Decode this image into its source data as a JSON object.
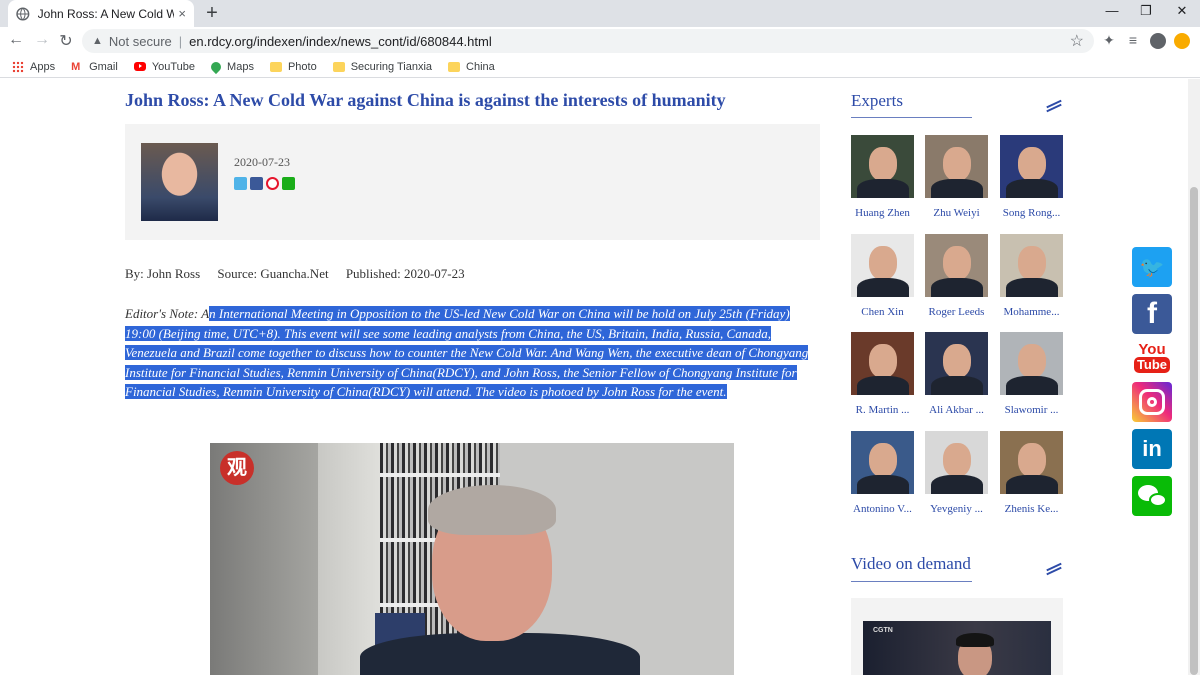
{
  "browser": {
    "tab_title": "John Ross: A New Cold War agai",
    "tab_close": "×",
    "new_tab": "+",
    "minimize": "—",
    "maximize": "❐",
    "close": "✕",
    "back": "←",
    "forward": "→",
    "reload": "↻",
    "security_label": "Not secure",
    "url": "en.rdcy.org/indexen/index/news_cont/id/680844.html",
    "bookmarks": [
      {
        "label": "Apps",
        "icon": "apps-grid-icon"
      },
      {
        "label": "Gmail",
        "icon": "gmail-icon"
      },
      {
        "label": "YouTube",
        "icon": "youtube-icon"
      },
      {
        "label": "Maps",
        "icon": "maps-pin-icon"
      },
      {
        "label": "Photo",
        "icon": "folder-icon"
      },
      {
        "label": "Securing Tianxia",
        "icon": "folder-icon"
      },
      {
        "label": "China",
        "icon": "folder-icon"
      }
    ]
  },
  "article": {
    "title": "John Ross: A New Cold War against China is against the interests of humanity",
    "date": "2020-07-23",
    "by": "By: John Ross",
    "source": "Source: Guancha.Net",
    "published": "Published: 2020-07-23",
    "note_lead": "Editor's Note: A",
    "note_body": "n International Meeting in Opposition to the US-led New Cold War on China will be hold on July 25th (Friday) 19:00 (Beijing time, UTC+8). This event will see some leading analysts from China, the US, Britain, India, Russia, Canada, Venezuela and Brazil come together to discuss how to counter the New Cold War. And Wang Wen, the executive dean of Chongyang Institute for Financial Studies, Renmin University of China(RDCY), and John Ross, the Senior Fellow of Chongyang Institute for Financial Studies, Renmin University of China(RDCY) will attend. The video is photoed by John Ross for the event.",
    "video_logo": "观"
  },
  "sidebar": {
    "experts_heading": "Experts",
    "experts": [
      {
        "name": "Huang Zhen"
      },
      {
        "name": "Zhu Weiyi"
      },
      {
        "name": "Song Rong..."
      },
      {
        "name": "Chen Xin"
      },
      {
        "name": "Roger Leeds"
      },
      {
        "name": "Mohamme..."
      },
      {
        "name": "R. Martin ..."
      },
      {
        "name": "Ali Akbar ..."
      },
      {
        "name": "Slawomir ..."
      },
      {
        "name": "Antonino V..."
      },
      {
        "name": "Yevgeniy ..."
      },
      {
        "name": "Zhenis Ke..."
      }
    ],
    "vod_heading": "Video on demand",
    "vod_logo": "CGTN"
  },
  "social": {
    "twitter": "🐦",
    "facebook": "f",
    "youtube_top": "You",
    "youtube_bottom": "Tube",
    "linkedin": "in"
  },
  "colors": {
    "link_blue": "#2d4ba8",
    "selection": "#2f66d8",
    "infobox_bg": "#f3f3f3"
  }
}
